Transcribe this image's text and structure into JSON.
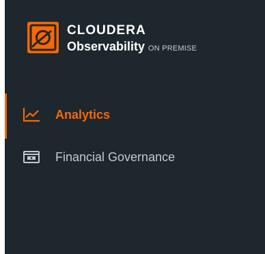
{
  "brand": {
    "company": "CLOUDERA",
    "product": "Observability",
    "edition": "ON PREMISE",
    "logo_icon": "cloudera-logo-icon"
  },
  "nav": {
    "items": [
      {
        "label": "Analytics",
        "icon": "line-chart-icon",
        "active": true
      },
      {
        "label": "Financial Governance",
        "icon": "card-icon",
        "active": false
      }
    ]
  },
  "colors": {
    "sidebar_bg": "#1d272d",
    "accent": "#f96702",
    "text_muted": "#c4c9cc",
    "text_white": "#ffffff"
  }
}
